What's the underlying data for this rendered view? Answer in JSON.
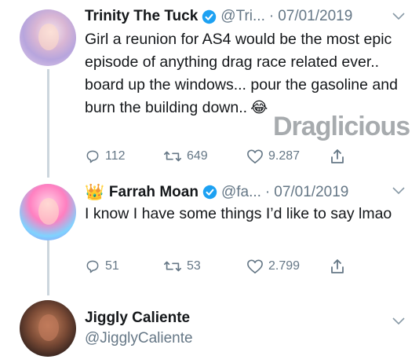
{
  "tweets": [
    {
      "name": "Trinity The Tuck",
      "handle": "@Tri...",
      "separator": "·",
      "date": "07/01/2019",
      "text": "Girl a reunion for AS4 would be the most epic episode of anything drag race related ever.. board up the windows... pour the gasoline and burn the building down..",
      "emoji": "😂",
      "replies": "112",
      "retweets": "649",
      "likes": "9.287"
    },
    {
      "name": "Farrah Moan",
      "name_emoji": "👑",
      "handle": "@fa...",
      "separator": "·",
      "date": "07/01/2019",
      "text": "I know I have some things I’d like to say lmao",
      "replies": "51",
      "retweets": "53",
      "likes": "2.799"
    }
  ],
  "profile": {
    "name": "Jiggly Caliente",
    "handle": "@JigglyCaliente"
  },
  "watermark": "Draglicious",
  "colors": {
    "verified": "#1da1f2",
    "secondary_text": "#657786",
    "thread_line": "#ccd6dd"
  },
  "icons": [
    "reply-icon",
    "retweet-icon",
    "like-icon",
    "share-icon",
    "verified-icon",
    "chevron-down-icon"
  ]
}
